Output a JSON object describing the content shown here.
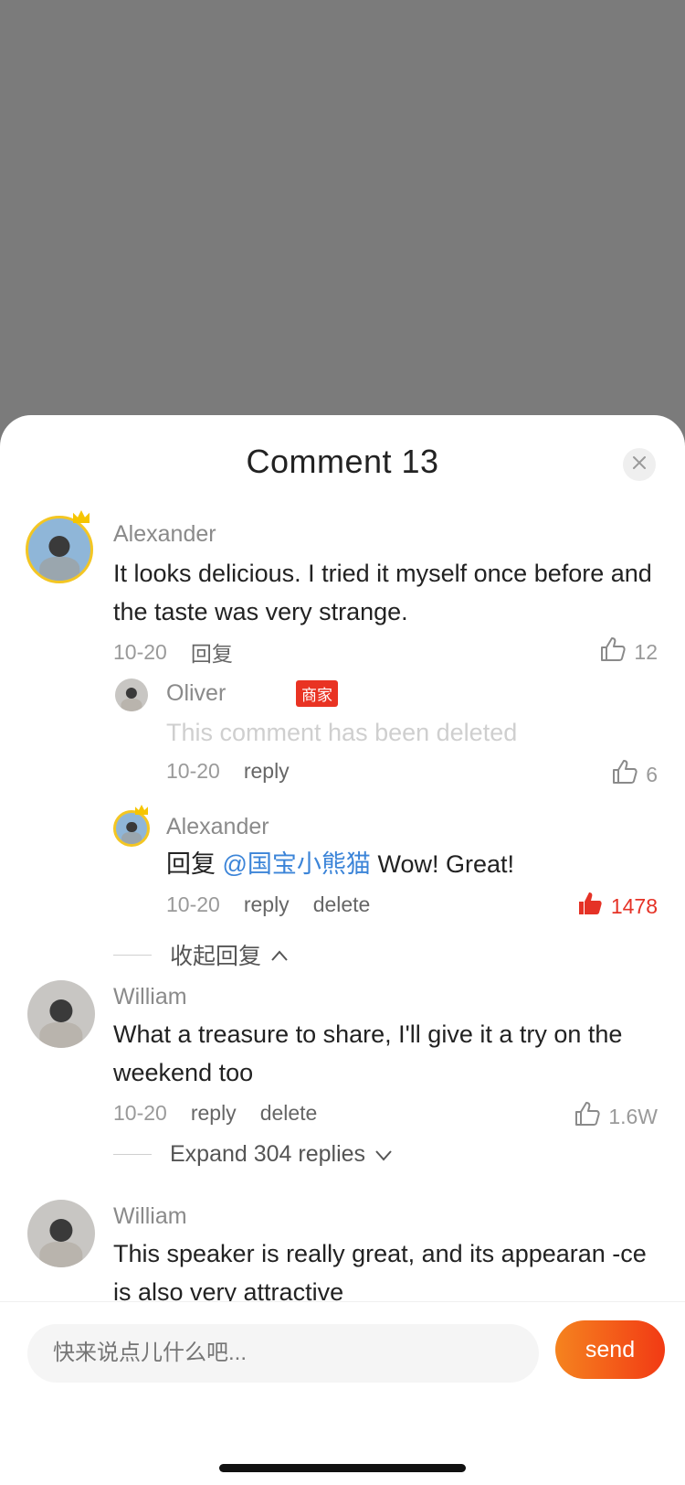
{
  "sheet": {
    "title": "Comment 13",
    "close_icon": "close-icon"
  },
  "comments": [
    {
      "author": "Alexander",
      "text": "It looks delicious. I tried it myself once before and the taste was very strange.",
      "date": "10-20",
      "action_reply": "回复",
      "likes": "12",
      "replies": [
        {
          "author": "Oliver",
          "badge": "商家",
          "text": "This comment has been deleted",
          "date": "10-20",
          "action_reply": "reply",
          "likes": "6"
        },
        {
          "author": "Alexander",
          "text_prefix": "回复",
          "mention": "@国宝小熊猫",
          "text": "Wow! Great!",
          "date": "10-20",
          "action_reply": "reply",
          "action_delete": "delete",
          "likes": "1478",
          "liked": true
        }
      ],
      "collapse_label": "收起回复"
    },
    {
      "author": "William",
      "text": "What a treasure to share, I'll give it a try on the weekend too",
      "date": "10-20",
      "action_reply": "reply",
      "action_delete": "delete",
      "likes": "1.6W",
      "expand_label": "Expand 304 replies"
    },
    {
      "author": "William",
      "text": "This speaker is really great, and its appearan -ce is also very attractive"
    }
  ],
  "composer": {
    "placeholder": "快来说点儿什么吧...",
    "send_label": "send"
  },
  "colors": {
    "accent": "#e93323",
    "mention": "#3b84d8",
    "send_gradient_start": "#f5831f",
    "send_gradient_end": "#f23a14"
  }
}
